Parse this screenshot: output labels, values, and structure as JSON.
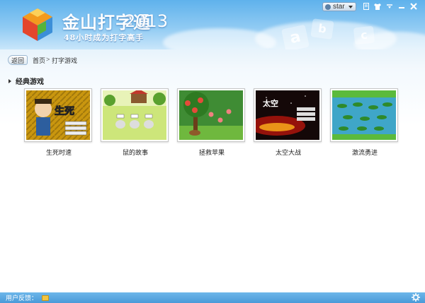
{
  "app": {
    "brand": "金山打字通",
    "year": "2013",
    "slogan": "48小时成为打字高手"
  },
  "titlebar": {
    "username": "star"
  },
  "breadcrumb": {
    "back_label": "返回",
    "items": [
      "首页",
      "打字游戏"
    ],
    "separator": ">"
  },
  "section": {
    "title": "经典游戏"
  },
  "games": [
    {
      "name": "生死时速"
    },
    {
      "name": "鼠的故事"
    },
    {
      "name": "拯救苹果"
    },
    {
      "name": "太空大战"
    },
    {
      "name": "激流勇进"
    }
  ],
  "statusbar": {
    "feedback_label": "用户反馈："
  },
  "icons": {
    "logo": "kingsoft-logo-icon",
    "user": "user-icon",
    "settings": "gear-icon",
    "mail": "mail-icon"
  },
  "colors": {
    "header_top": "#5fb2ec",
    "statusbar": "#4a9ad8"
  }
}
